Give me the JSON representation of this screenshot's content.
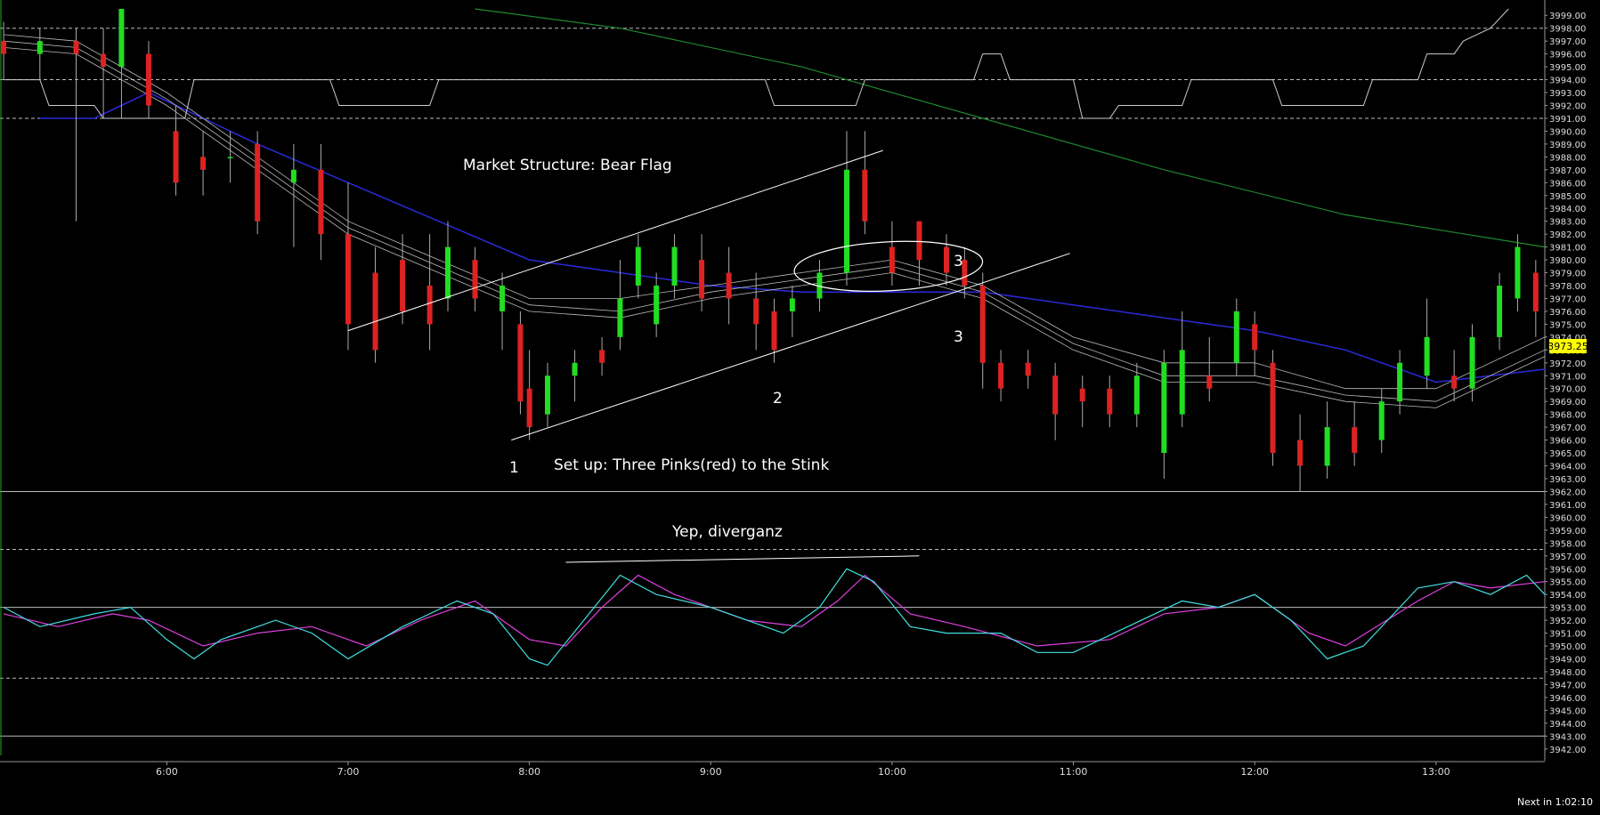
{
  "annotations": {
    "market_structure": "Market Structure:  Bear Flag",
    "setup": "Set up:  Three Pinks(red) to the Stink",
    "divergence": "Yep, diverganz",
    "point1": "1",
    "point2": "2",
    "point3a": "3",
    "point3b": "3"
  },
  "footer": {
    "next_bar": "Next in 1:02:10"
  },
  "price_tag": "3973.25",
  "colors": {
    "bull": "#22dd22",
    "bear": "#dd2222",
    "ema": "#2a2ad8",
    "sma_long": "#1f8a2f",
    "stoch_k": "#40e0e0",
    "stoch_d": "#e040e0",
    "vwap_band": "#bbbbbb",
    "price_tag_bg": "#ffff00"
  },
  "chart_data": {
    "type": "candlestick",
    "y_axis_ticks": [
      "3999.00",
      "3998.00",
      "3997.00",
      "3996.00",
      "3995.00",
      "3994.00",
      "3993.00",
      "3992.00",
      "3991.00",
      "3990.00",
      "3989.00",
      "3988.00",
      "3987.00",
      "3986.00",
      "3985.00",
      "3984.00",
      "3983.00",
      "3982.00",
      "3981.00",
      "3980.00",
      "3979.00",
      "3978.00",
      "3977.00",
      "3976.00",
      "3975.00",
      "3974.00",
      "3973.00",
      "3972.00",
      "3971.00",
      "3970.00",
      "3969.00",
      "3968.00",
      "3967.00",
      "3966.00",
      "3965.00",
      "3964.00",
      "3963.00",
      "3962.00",
      "3961.00",
      "3960.00",
      "3959.00",
      "3958.00",
      "3957.00",
      "3956.00",
      "3955.00",
      "3954.00",
      "3953.00",
      "3952.00",
      "3951.00",
      "3950.00",
      "3949.00",
      "3948.00",
      "3947.00",
      "3946.00",
      "3945.00",
      "3944.00",
      "3943.00",
      "3942.00"
    ],
    "y_range": [
      3941.5,
      3999.5
    ],
    "x_axis_ticks": [
      {
        "label": "6:00",
        "t": 6.0
      },
      {
        "label": "7:00",
        "t": 7.0
      },
      {
        "label": "8:00",
        "t": 8.0
      },
      {
        "label": "9:00",
        "t": 9.0
      },
      {
        "label": "10:00",
        "t": 10.0
      },
      {
        "label": "11:00",
        "t": 11.0
      },
      {
        "label": "12:00",
        "t": 12.0
      },
      {
        "label": "13:00",
        "t": 13.0
      }
    ],
    "x_range": [
      5.08,
      13.6
    ],
    "candles": [
      {
        "t": 5.1,
        "o": 3997,
        "h": 3998.5,
        "l": 3994,
        "c": 3996
      },
      {
        "t": 5.3,
        "o": 3996,
        "h": 3998,
        "l": 3994,
        "c": 3997
      },
      {
        "t": 5.5,
        "o": 3997,
        "h": 3998,
        "l": 3983,
        "c": 3996
      },
      {
        "t": 5.65,
        "o": 3996,
        "h": 3998,
        "l": 3991,
        "c": 3995
      },
      {
        "t": 5.75,
        "o": 3995,
        "h": 3999.5,
        "l": 3991,
        "c": 3999.5
      },
      {
        "t": 5.9,
        "o": 3996,
        "h": 3997,
        "l": 3991,
        "c": 3992
      },
      {
        "t": 6.05,
        "o": 3990,
        "h": 3992,
        "l": 3985,
        "c": 3986
      },
      {
        "t": 6.2,
        "o": 3988,
        "h": 3990,
        "l": 3985,
        "c": 3987
      },
      {
        "t": 6.35,
        "o": 3988,
        "h": 3990,
        "l": 3986,
        "c": 3988
      },
      {
        "t": 6.5,
        "o": 3989,
        "h": 3990,
        "l": 3982,
        "c": 3983
      },
      {
        "t": 6.7,
        "o": 3986,
        "h": 3989,
        "l": 3981,
        "c": 3987
      },
      {
        "t": 6.85,
        "o": 3987,
        "h": 3989,
        "l": 3980,
        "c": 3982
      },
      {
        "t": 7.0,
        "o": 3982,
        "h": 3986,
        "l": 3973,
        "c": 3975
      },
      {
        "t": 7.15,
        "o": 3979,
        "h": 3981,
        "l": 3972,
        "c": 3973
      },
      {
        "t": 7.3,
        "o": 3980,
        "h": 3982,
        "l": 3975,
        "c": 3976
      },
      {
        "t": 7.45,
        "o": 3978,
        "h": 3982,
        "l": 3973,
        "c": 3975
      },
      {
        "t": 7.55,
        "o": 3977,
        "h": 3983,
        "l": 3976,
        "c": 3981
      },
      {
        "t": 7.7,
        "o": 3980,
        "h": 3981,
        "l": 3976,
        "c": 3977
      },
      {
        "t": 7.85,
        "o": 3976,
        "h": 3979,
        "l": 3973,
        "c": 3978
      },
      {
        "t": 7.95,
        "o": 3975,
        "h": 3976,
        "l": 3968,
        "c": 3969
      },
      {
        "t": 8.0,
        "o": 3970,
        "h": 3973,
        "l": 3966,
        "c": 3967
      },
      {
        "t": 8.1,
        "o": 3968,
        "h": 3972,
        "l": 3967,
        "c": 3971
      },
      {
        "t": 8.25,
        "o": 3971,
        "h": 3973,
        "l": 3969,
        "c": 3972
      },
      {
        "t": 8.4,
        "o": 3973,
        "h": 3974,
        "l": 3971,
        "c": 3972
      },
      {
        "t": 8.5,
        "o": 3974,
        "h": 3980,
        "l": 3973,
        "c": 3977
      },
      {
        "t": 8.6,
        "o": 3978,
        "h": 3982,
        "l": 3977,
        "c": 3981
      },
      {
        "t": 8.7,
        "o": 3975,
        "h": 3979,
        "l": 3974,
        "c": 3978
      },
      {
        "t": 8.8,
        "o": 3978,
        "h": 3982,
        "l": 3977,
        "c": 3981
      },
      {
        "t": 8.95,
        "o": 3980,
        "h": 3982,
        "l": 3976,
        "c": 3977
      },
      {
        "t": 9.1,
        "o": 3979,
        "h": 3981,
        "l": 3975,
        "c": 3977
      },
      {
        "t": 9.25,
        "o": 3977,
        "h": 3979,
        "l": 3973,
        "c": 3975
      },
      {
        "t": 9.35,
        "o": 3976,
        "h": 3977,
        "l": 3972,
        "c": 3973
      },
      {
        "t": 9.45,
        "o": 3976,
        "h": 3978,
        "l": 3974,
        "c": 3977
      },
      {
        "t": 9.6,
        "o": 3977,
        "h": 3980,
        "l": 3976,
        "c": 3979
      },
      {
        "t": 9.75,
        "o": 3979,
        "h": 3990,
        "l": 3978,
        "c": 3987
      },
      {
        "t": 9.85,
        "o": 3987,
        "h": 3990,
        "l": 3982,
        "c": 3983
      },
      {
        "t": 10.0,
        "o": 3981,
        "h": 3983,
        "l": 3978,
        "c": 3979
      },
      {
        "t": 10.15,
        "o": 3983,
        "h": 3983,
        "l": 3978,
        "c": 3980
      },
      {
        "t": 10.3,
        "o": 3981,
        "h": 3982,
        "l": 3978,
        "c": 3979
      },
      {
        "t": 10.4,
        "o": 3980,
        "h": 3981,
        "l": 3977,
        "c": 3978
      },
      {
        "t": 10.5,
        "o": 3978,
        "h": 3979,
        "l": 3970,
        "c": 3972
      },
      {
        "t": 10.6,
        "o": 3972,
        "h": 3973,
        "l": 3969,
        "c": 3970
      },
      {
        "t": 10.75,
        "o": 3972,
        "h": 3973,
        "l": 3970,
        "c": 3971
      },
      {
        "t": 10.9,
        "o": 3971,
        "h": 3972,
        "l": 3966,
        "c": 3968
      },
      {
        "t": 11.05,
        "o": 3970,
        "h": 3971,
        "l": 3967,
        "c": 3969
      },
      {
        "t": 11.2,
        "o": 3970,
        "h": 3971,
        "l": 3967,
        "c": 3968
      },
      {
        "t": 11.35,
        "o": 3968,
        "h": 3972,
        "l": 3967,
        "c": 3971
      },
      {
        "t": 11.5,
        "o": 3965,
        "h": 3973,
        "l": 3963,
        "c": 3972
      },
      {
        "t": 11.6,
        "o": 3968,
        "h": 3976,
        "l": 3967,
        "c": 3973
      },
      {
        "t": 11.75,
        "o": 3971,
        "h": 3974,
        "l": 3969,
        "c": 3970
      },
      {
        "t": 11.9,
        "o": 3972,
        "h": 3977,
        "l": 3971,
        "c": 3976
      },
      {
        "t": 12.0,
        "o": 3975,
        "h": 3976,
        "l": 3971,
        "c": 3973
      },
      {
        "t": 12.1,
        "o": 3972,
        "h": 3973,
        "l": 3964,
        "c": 3965
      },
      {
        "t": 12.25,
        "o": 3966,
        "h": 3968,
        "l": 3962,
        "c": 3964
      },
      {
        "t": 12.4,
        "o": 3964,
        "h": 3969,
        "l": 3963,
        "c": 3967
      },
      {
        "t": 12.55,
        "o": 3967,
        "h": 3969,
        "l": 3964,
        "c": 3965
      },
      {
        "t": 12.7,
        "o": 3966,
        "h": 3970,
        "l": 3965,
        "c": 3969
      },
      {
        "t": 12.8,
        "o": 3969,
        "h": 3973,
        "l": 3968,
        "c": 3972
      },
      {
        "t": 12.95,
        "o": 3971,
        "h": 3977,
        "l": 3970,
        "c": 3974
      },
      {
        "t": 13.1,
        "o": 3971,
        "h": 3973,
        "l": 3969,
        "c": 3970
      },
      {
        "t": 13.2,
        "o": 3970,
        "h": 3975,
        "l": 3969,
        "c": 3974
      },
      {
        "t": 13.35,
        "o": 3974,
        "h": 3979,
        "l": 3973,
        "c": 3978
      },
      {
        "t": 13.45,
        "o": 3977,
        "h": 3982,
        "l": 3976,
        "c": 3981
      },
      {
        "t": 13.55,
        "o": 3979,
        "h": 3980,
        "l": 3974,
        "c": 3976
      }
    ],
    "ema": [
      [
        5.3,
        3991
      ],
      [
        5.6,
        3991
      ],
      [
        5.9,
        3993
      ],
      [
        6.2,
        3991
      ],
      [
        6.5,
        3989
      ],
      [
        7.0,
        3986
      ],
      [
        7.5,
        3983
      ],
      [
        8.0,
        3980
      ],
      [
        8.5,
        3979
      ],
      [
        9.0,
        3978
      ],
      [
        9.5,
        3977.5
      ],
      [
        10.0,
        3977.5
      ],
      [
        10.5,
        3977.5
      ],
      [
        11.0,
        3976.5
      ],
      [
        11.5,
        3975.5
      ],
      [
        12.0,
        3974.5
      ],
      [
        12.5,
        3973
      ],
      [
        13.0,
        3970.5
      ],
      [
        13.6,
        3971.5
      ]
    ],
    "sma_long": [
      [
        7.7,
        3999.5
      ],
      [
        8.5,
        3998
      ],
      [
        9.5,
        3995
      ],
      [
        10.5,
        3991
      ],
      [
        11.5,
        3987
      ],
      [
        12.5,
        3983.5
      ],
      [
        13.6,
        3981
      ]
    ],
    "bands": [
      [
        [
          5.1,
          3997.5
        ],
        [
          5.5,
          3997
        ],
        [
          6.0,
          3993
        ],
        [
          6.5,
          3988
        ],
        [
          7.0,
          3983
        ],
        [
          7.5,
          3980
        ],
        [
          8.0,
          3977
        ],
        [
          8.5,
          3977
        ],
        [
          9.0,
          3978
        ],
        [
          9.5,
          3979
        ],
        [
          10.0,
          3980
        ],
        [
          10.5,
          3978
        ],
        [
          11.0,
          3974
        ],
        [
          11.5,
          3972
        ],
        [
          12.0,
          3972
        ],
        [
          12.5,
          3970
        ],
        [
          13.0,
          3970
        ],
        [
          13.6,
          3974
        ]
      ],
      [
        [
          5.1,
          3997
        ],
        [
          5.5,
          3996.5
        ],
        [
          6.0,
          3992.5
        ],
        [
          6.5,
          3987.5
        ],
        [
          7.0,
          3982.5
        ],
        [
          7.5,
          3979.5
        ],
        [
          8.0,
          3976.5
        ],
        [
          8.5,
          3976
        ],
        [
          9.0,
          3977.5
        ],
        [
          9.5,
          3978.5
        ],
        [
          10.0,
          3979.5
        ],
        [
          10.5,
          3977.5
        ],
        [
          11.0,
          3973.5
        ],
        [
          11.5,
          3971
        ],
        [
          12.0,
          3971
        ],
        [
          12.5,
          3969.5
        ],
        [
          13.0,
          3969
        ],
        [
          13.6,
          3973
        ]
      ],
      [
        [
          5.1,
          3996.5
        ],
        [
          5.5,
          3996
        ],
        [
          6.0,
          3992
        ],
        [
          6.5,
          3987
        ],
        [
          7.0,
          3982
        ],
        [
          7.5,
          3979
        ],
        [
          8.0,
          3976
        ],
        [
          8.5,
          3975.5
        ],
        [
          9.0,
          3977
        ],
        [
          9.5,
          3978
        ],
        [
          10.0,
          3979
        ],
        [
          10.5,
          3977
        ],
        [
          11.0,
          3973
        ],
        [
          11.5,
          3970.5
        ],
        [
          12.0,
          3970.5
        ],
        [
          12.5,
          3969
        ],
        [
          13.0,
          3968.5
        ],
        [
          13.6,
          3972.5
        ]
      ]
    ],
    "step_line": [
      [
        5.1,
        3994
      ],
      [
        5.3,
        3994
      ],
      [
        5.35,
        3992
      ],
      [
        5.6,
        3992
      ],
      [
        5.65,
        3991
      ],
      [
        6.1,
        3991
      ],
      [
        6.15,
        3994
      ],
      [
        6.9,
        3994
      ],
      [
        6.95,
        3992
      ],
      [
        7.45,
        3992
      ],
      [
        7.5,
        3994
      ],
      [
        9.3,
        3994
      ],
      [
        9.35,
        3992
      ],
      [
        9.8,
        3992
      ],
      [
        9.85,
        3994
      ],
      [
        10.45,
        3994
      ],
      [
        10.5,
        3996
      ],
      [
        10.6,
        3996
      ],
      [
        10.65,
        3994
      ],
      [
        11.0,
        3994
      ],
      [
        11.05,
        3991
      ],
      [
        11.2,
        3991
      ],
      [
        11.25,
        3992
      ],
      [
        11.6,
        3992
      ],
      [
        11.65,
        3994
      ],
      [
        12.1,
        3994
      ],
      [
        12.15,
        3992
      ],
      [
        12.6,
        3992
      ],
      [
        12.65,
        3994
      ],
      [
        12.9,
        3994
      ],
      [
        12.95,
        3996
      ],
      [
        13.1,
        3996
      ],
      [
        13.15,
        3997
      ],
      [
        13.3,
        3998
      ],
      [
        13.4,
        3999.5
      ]
    ],
    "stoch_k": [
      [
        5.1,
        3953
      ],
      [
        5.3,
        3951.5
      ],
      [
        5.6,
        3952.5
      ],
      [
        5.8,
        3953
      ],
      [
        6.0,
        3950.5
      ],
      [
        6.15,
        3949
      ],
      [
        6.3,
        3950.5
      ],
      [
        6.6,
        3952
      ],
      [
        6.8,
        3951
      ],
      [
        7.0,
        3949
      ],
      [
        7.3,
        3951.5
      ],
      [
        7.6,
        3953.5
      ],
      [
        7.8,
        3952.5
      ],
      [
        8.0,
        3949
      ],
      [
        8.1,
        3948.5
      ],
      [
        8.3,
        3952
      ],
      [
        8.5,
        3955.5
      ],
      [
        8.7,
        3954
      ],
      [
        9.0,
        3953
      ],
      [
        9.4,
        3951
      ],
      [
        9.6,
        3953
      ],
      [
        9.75,
        3956
      ],
      [
        9.9,
        3955
      ],
      [
        10.1,
        3951.5
      ],
      [
        10.3,
        3951
      ],
      [
        10.6,
        3951
      ],
      [
        10.8,
        3949.5
      ],
      [
        11.0,
        3949.5
      ],
      [
        11.3,
        3951.5
      ],
      [
        11.6,
        3953.5
      ],
      [
        11.8,
        3953
      ],
      [
        12.0,
        3954
      ],
      [
        12.2,
        3952
      ],
      [
        12.4,
        3949
      ],
      [
        12.6,
        3950
      ],
      [
        12.9,
        3954.5
      ],
      [
        13.1,
        3955
      ],
      [
        13.3,
        3954
      ],
      [
        13.5,
        3955.5
      ],
      [
        13.6,
        3954
      ]
    ],
    "stoch_d": [
      [
        5.1,
        3952.5
      ],
      [
        5.4,
        3951.5
      ],
      [
        5.7,
        3952.5
      ],
      [
        5.9,
        3952
      ],
      [
        6.2,
        3950
      ],
      [
        6.5,
        3951
      ],
      [
        6.8,
        3951.5
      ],
      [
        7.1,
        3950
      ],
      [
        7.4,
        3952
      ],
      [
        7.7,
        3953.5
      ],
      [
        8.0,
        3950.5
      ],
      [
        8.2,
        3950
      ],
      [
        8.4,
        3953
      ],
      [
        8.6,
        3955.5
      ],
      [
        8.8,
        3954
      ],
      [
        9.2,
        3952
      ],
      [
        9.5,
        3951.5
      ],
      [
        9.7,
        3953.5
      ],
      [
        9.85,
        3955.5
      ],
      [
        10.1,
        3952.5
      ],
      [
        10.4,
        3951.5
      ],
      [
        10.8,
        3950
      ],
      [
        11.2,
        3950.5
      ],
      [
        11.5,
        3952.5
      ],
      [
        11.8,
        3953
      ],
      [
        12.0,
        3954
      ],
      [
        12.3,
        3951
      ],
      [
        12.5,
        3950
      ],
      [
        12.9,
        3953.5
      ],
      [
        13.1,
        3955
      ],
      [
        13.3,
        3954.5
      ],
      [
        13.6,
        3955
      ]
    ],
    "h_lines": [
      {
        "y": 3998,
        "style": "dashed"
      },
      {
        "y": 3994,
        "style": "dashed"
      },
      {
        "y": 3991,
        "style": "dashed"
      },
      {
        "y": 3962,
        "style": "solid"
      },
      {
        "y": 3957.5,
        "style": "dashed"
      },
      {
        "y": 3953,
        "style": "solid"
      },
      {
        "y": 3947.5,
        "style": "dashed"
      },
      {
        "y": 3943,
        "style": "solid"
      }
    ],
    "channel": {
      "upper": [
        [
          7.0,
          3974.5
        ],
        [
          9.95,
          3988.5
        ]
      ],
      "lower": [
        [
          7.9,
          3966
        ],
        [
          10.35,
          3977.5
        ]
      ],
      "lower_ext": [
        [
          10.35,
          3977.5
        ],
        [
          10.98,
          3980.5
        ]
      ]
    },
    "divergence_line": [
      [
        8.2,
        3956.5
      ],
      [
        10.15,
        3957
      ]
    ],
    "ellipse": {
      "cx": 9.98,
      "cy": 3979.5,
      "rt": 0.52,
      "ry": 1.9
    }
  }
}
